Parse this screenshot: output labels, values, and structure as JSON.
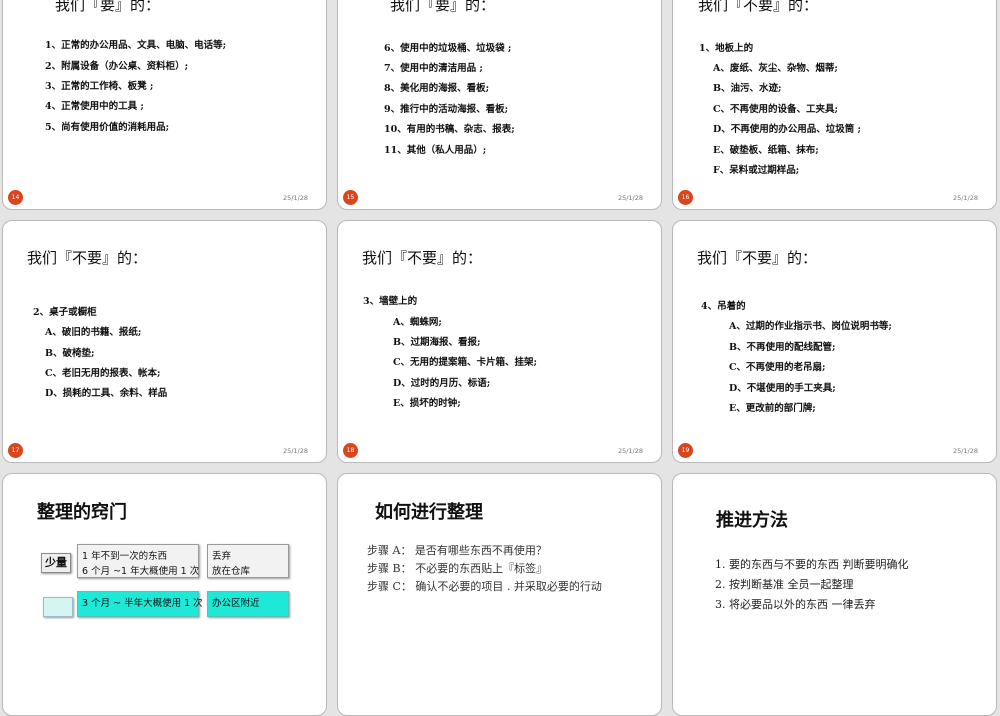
{
  "colors": {
    "badge": "#d9461d",
    "highlight": "#1ee8d6",
    "background": "#e4e4e4"
  },
  "slides": [
    {
      "number": "14",
      "date": "25/1/28",
      "title": "我们『要』的：",
      "lines": [
        "1、正常的办公用品、文具、电脑、电话等;",
        "2、附属设备（办公桌、资料柜）;",
        "3、正常的工作椅、板凳 ;",
        "4、正常使用中的工具 ;",
        "5、尚有使用价值的消耗用品;"
      ]
    },
    {
      "number": "15",
      "date": "25/1/28",
      "title": "我们『要』的：",
      "lines": [
        "6、使用中的垃圾桶、垃圾袋 ;",
        "7、使用中的清洁用品 ;",
        "8、美化用的海报、看板;",
        "9、推行中的活动海报、看板;",
        "10、有用的书稿、杂志、报表;",
        "11、其他（私人用品）;"
      ]
    },
    {
      "number": "16",
      "date": "25/1/28",
      "title": "我们『不要』的：",
      "lines": [
        "1、地板上的",
        "A、废纸、灰尘、杂物、烟蒂;",
        "B、油污、水迹;",
        "C、不再使用的设备、工夹具;",
        "D、不再使用的办公用品、垃圾筒 ;",
        "E、破垫板、纸箱、抹布;",
        "F、呆料或过期样品;"
      ]
    },
    {
      "number": "17",
      "date": "25/1/28",
      "title": "我们『不要』的：",
      "lines": [
        "2、桌子或橱柜",
        "A、破旧的书籍、报纸;",
        "B、破椅垫;",
        "C、老旧无用的报表、帐本;",
        "D、损耗的工具、余料、样品"
      ]
    },
    {
      "number": "18",
      "date": "25/1/28",
      "title": "我们『不要』的：",
      "lines": [
        "3、墙壁上的",
        "A、蜘蛛网;",
        "B、过期海报、看报;",
        "C、无用的提案箱、卡片箱、挂架;",
        "D、过时的月历、标语;",
        "E、损坏的时钟;"
      ]
    },
    {
      "number": "19",
      "date": "25/1/28",
      "title": "我们『不要』的：",
      "lines": [
        "4、吊着的",
        "A、过期的作业指示书、岗位说明书等;",
        "B、不再使用的配线配管;",
        "C、不再使用的老吊扇;",
        "D、不堪使用的手工夹具;",
        "E、更改前的部门牌;"
      ]
    },
    {
      "title": "整理的窍门",
      "qty_label": "少量",
      "box1": [
        "1 年不到一次的东西",
        "6 个月 ~1 年大概使用 1 次"
      ],
      "box2": [
        "丢弃",
        "放在仓库"
      ],
      "box3": [
        "3 个月 ~ 半年大概使用 1 次"
      ],
      "box4": [
        "办公区附近"
      ]
    },
    {
      "title": "如何进行整理",
      "steps": [
        "步骤 A： 是否有哪些东西不再使用？",
        "步骤 B： 不必要的东西贴上『标签』",
        "步骤 C： 确认不必要的项目 . 并采取必要的行动"
      ]
    },
    {
      "title": "推进方法",
      "items": [
        "1. 要的东西与不要的东西 判断要明确化",
        "2. 按判断基准 全员一起整理",
        "3. 将必要品以外的东西 一律丢弃"
      ]
    }
  ]
}
